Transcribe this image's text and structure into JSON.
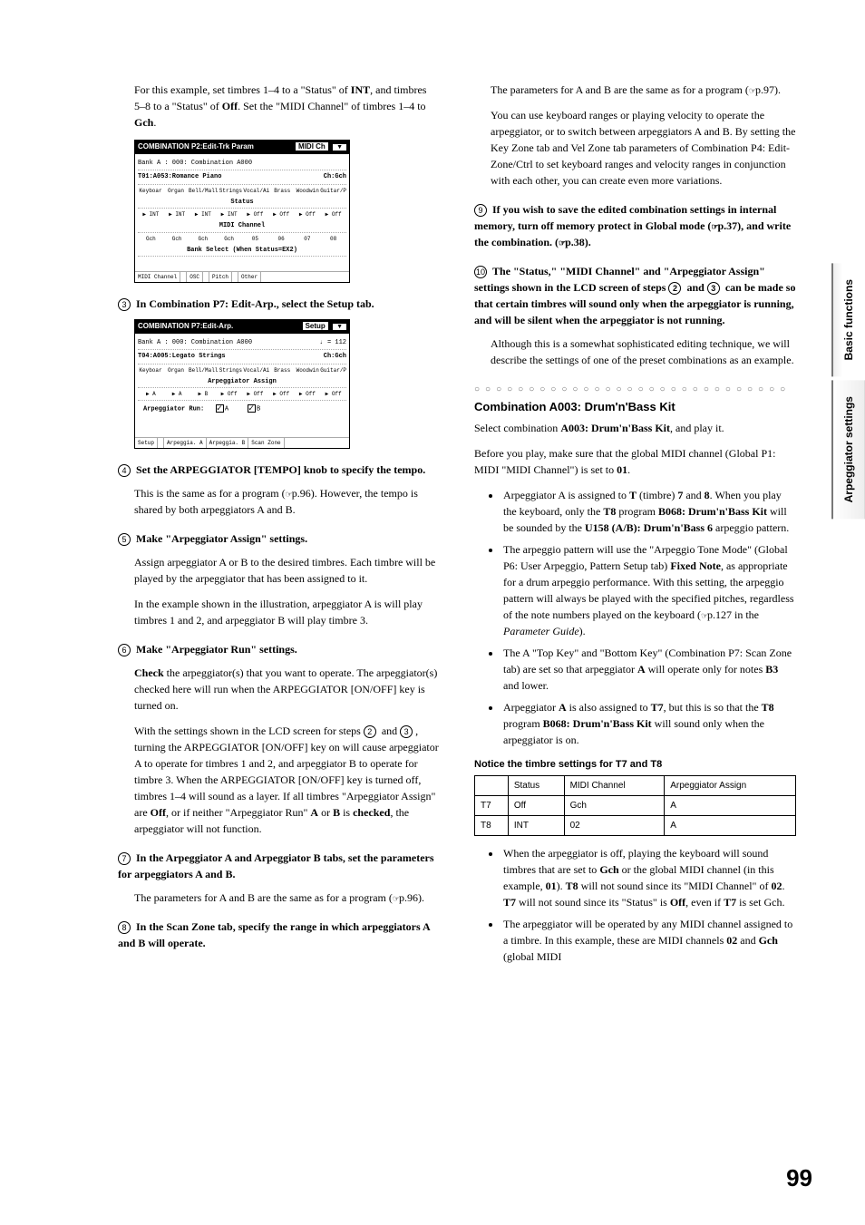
{
  "page_number": "99",
  "side_tabs": {
    "top": "Basic functions",
    "bottom": "Arpeggiator settings"
  },
  "left": {
    "intro": {
      "p1a": "For this example, set timbres 1–4 to a \"Status\" of ",
      "p1_int": "INT",
      "p1b": ", and timbres 5–8 to a \"Status\" of ",
      "p1_off": "Off",
      "p1c": ". Set the \"MIDI Channel\" of timbres 1–4 to ",
      "p1_gch": "Gch",
      "p1d": "."
    },
    "screenshot1": {
      "title": "COMBINATION P2:Edit-Trk Param",
      "title_label": "MIDI Ch",
      "bank_line": "Bank A : 000: Combination A000",
      "t01": "T01:A053:Romance Piano",
      "ch": "Ch:Gch",
      "instr": [
        "Keyboar",
        "Organ",
        "Bell/Mall",
        "Strings",
        "Vocal/Ai",
        "Brass",
        "Woodwin",
        "Guitar/P"
      ],
      "status_label": "Status",
      "status_row": [
        "▶ INT",
        "▶ INT",
        "▶ INT",
        "▶ INT",
        "▶ Off",
        "▶ Off",
        "▶ Off",
        "▶ Off"
      ],
      "midi_ch_label": "MIDI Channel",
      "midi_ch_row": [
        "Gch",
        "Gch",
        "Gch",
        "Gch",
        "05",
        "06",
        "07",
        "08"
      ],
      "bank_sel_label": "Bank Select (When Status=EX2)",
      "tabs": [
        "MIDI Channel",
        "",
        "OSC",
        "",
        "Pitch",
        "",
        "Other"
      ]
    },
    "step3": "In Combination P7: Edit-Arp., select the Setup tab.",
    "screenshot2": {
      "title": "COMBINATION P7:Edit-Arp.",
      "title_label": "Setup",
      "bank_line": "Bank A : 000: Combination A000",
      "tempo": "= 112",
      "t04": "T04:A005:Legato Strings",
      "ch": "Ch:Gch",
      "instr": [
        "Keyboar",
        "Organ",
        "Bell/Mall",
        "Strings",
        "Vocal/Ai",
        "Brass",
        "Woodwin",
        "Guitar/P"
      ],
      "assign_label": "Arpeggiator Assign",
      "assign_row": [
        "▶ A",
        "▶ A",
        "▶ B",
        "▶ Off",
        "▶ Off",
        "▶ Off",
        "▶ Off",
        "▶ Off"
      ],
      "run_label": "Arpeggiator Run:",
      "run_a": "A",
      "run_b": "B",
      "tabs": [
        "Setup",
        "",
        "Arpeggia. A",
        "Arpeggia. B",
        "Scan Zone"
      ]
    },
    "step4": "Set the ARPEGGIATOR [TEMPO] knob to specify the tempo.",
    "step4_p_a": "This is the same as for a program (",
    "step4_p_ref": "p.96",
    "step4_p_b": "). However, the tempo is shared by both arpeggiators A and B.",
    "step5": "Make \"Arpeggiator Assign\" settings.",
    "step5_p1": "Assign arpeggiator A or B to the desired timbres. Each timbre will be played by the arpeggiator that has been assigned to it.",
    "step5_p2": "In the example shown in the illustration, arpeggiator A is will play timbres 1 and 2, and arpeggiator B will play timbre 3.",
    "step6": "Make \"Arpeggiator Run\" settings.",
    "step6_p1_a": "Check",
    "step6_p1_b": " the arpeggiator(s) that you want to operate. The arpeggiator(s) checked here will run when the ARPEGGIATOR [ON/OFF] key is turned on.",
    "step6_p2_a": "With the settings shown in the LCD screen for steps ",
    "step6_p2_b": " and ",
    "step6_p2_c": ", turning the ARPEGGIATOR [ON/OFF] key on will cause arpeggiator A to operate for timbres 1 and 2, and arpeggiator B to operate for timbre 3. When the ARPEGGIATOR [ON/OFF] key is turned off, timbres 1–4 will sound as a layer.",
    "step6_p3_a": "If all timbres \"Arpeggiator Assign\" are ",
    "step6_p3_off": "Off",
    "step6_p3_b": ", or if neither \"Arpeggiator Run\" ",
    "step6_p3_A": "A",
    "step6_p3_c": " or ",
    "step6_p3_B": "B",
    "step6_p3_d": " is ",
    "step6_p3_checked": "checked",
    "step6_p3_e": ", the arpeggiator will not function.",
    "step7": "In the Arpeggiator A and Arpeggiator B tabs, set the parameters for arpeggiators A and B.",
    "step7_p_a": "The parameters for A and B are the same as for a program (",
    "step7_p_ref": "p.96",
    "step7_p_b": ").",
    "step8": "In the Scan Zone tab, specify the range in which arpeggiators A and B will operate."
  },
  "right": {
    "p1_a": "The parameters for A and B are the same as for a program (",
    "p1_ref": "p.97",
    "p1_b": ").",
    "p2": "You can use keyboard ranges or playing velocity to operate the arpeggiator, or to switch between arpeggiators A and B. By setting the Key Zone tab and Vel Zone tab parameters of Combination P4: Edit-Zone/Ctrl to set keyboard ranges and velocity ranges in conjunction with each other, you can create even more variations.",
    "step9_a": "If you wish to save the edited combination settings in internal memory, turn off memory protect in Global mode (",
    "step9_ref1": "p.37",
    "step9_b": "), and write the combination. (",
    "step9_ref2": "p.38",
    "step9_c": ").",
    "step10_a": "The \"Status,\" \"MIDI Channel\" and \"Arpeggiator Assign\" settings shown in the LCD screen of steps ",
    "step10_b": " and ",
    "step10_c": " can be made so that certain timbres will sound only when the arpeggiator is running, and will be silent when the arpeggiator is not running.",
    "p3": "Although this is a somewhat sophisticated editing technique, we will describe the settings of one of the preset combinations as an example.",
    "section_head": "Combination A003: Drum'n'Bass Kit",
    "p4_a": "Select combination ",
    "p4_bold": "A003: Drum'n'Bass Kit",
    "p4_b": ", and play it.",
    "p5_a": "Before you play, make sure that the global MIDI channel (Global P1: MIDI \"MIDI Channel\") is set to ",
    "p5_bold": "01",
    "p5_b": ".",
    "bullets1": {
      "b1_a": "Arpeggiator A is assigned to ",
      "b1_T": "T",
      "b1_b": " (timbre) ",
      "b1_7": "7",
      "b1_c": " and ",
      "b1_8": "8",
      "b1_d": ". When you play the keyboard, only the ",
      "b1_T8": "T8",
      "b1_e": " program ",
      "b1_prog": "B068: Drum'n'Bass Kit",
      "b1_f": " will be sounded by the ",
      "b1_u158": "U158 (A/B): Drum'n'Bass 6",
      "b1_g": " arpeggio pattern.",
      "b2_a": "The arpeggio pattern will use the \"Arpeggio Tone Mode\" (Global P6: User Arpeggio, Pattern Setup tab) ",
      "b2_fixed": "Fixed Note",
      "b2_b": ", as appropriate for a drum arpeggio performance. With this setting, the arpeggio pattern will always be played with the specified pitches, regardless of the note numbers played on the keyboard (",
      "b2_ref": "p.127",
      "b2_c": " in the ",
      "b2_guide": "Parameter Guide",
      "b2_d": ").",
      "b3_a": "The A \"Top Key\" and \"Bottom Key\" (Combination P7: Scan Zone tab) are set so that arpeggiator ",
      "b3_A": "A",
      "b3_b": " will operate only for notes ",
      "b3_B3": "B3",
      "b3_c": " and lower.",
      "b4_a": "Arpeggiator ",
      "b4_A": "A",
      "b4_b": " is also assigned to ",
      "b4_T7": "T7",
      "b4_c": ", but this is so that the ",
      "b4_T8": "T8",
      "b4_d": " program ",
      "b4_prog": "B068: Drum'n'Bass Kit",
      "b4_e": " will sound only when the arpeggiator is on."
    },
    "sub_head": "Notice the timbre settings for T7 and T8",
    "table": {
      "h1": "Status",
      "h2": "MIDI Channel",
      "h3": "Arpeggiator Assign",
      "r1c0": "T7",
      "r1c1": "Off",
      "r1c2": "Gch",
      "r1c3": "A",
      "r2c0": "T8",
      "r2c1": "INT",
      "r2c2": "02",
      "r2c3": "A"
    },
    "bullets2": {
      "b1_a": "When the arpeggiator is off, playing the keyboard will sound timbres that are set to ",
      "b1_gch": "Gch",
      "b1_b": " or the global MIDI channel (in this example, ",
      "b1_01": "01",
      "b1_c": "). ",
      "b1_T8": "T8",
      "b1_d": " will not sound since its \"MIDI Channel\" of ",
      "b1_02": "02",
      "b1_e": ". ",
      "b1_T7": "T7",
      "b1_f": " will not sound since its \"Status\" is ",
      "b1_off": "Off",
      "b1_g": ", even if ",
      "b1_T7b": "T7",
      "b1_h": " is set Gch.",
      "b2_a": "The arpeggiator will be operated by any MIDI channel assigned to a timbre. In this example, these are MIDI channels ",
      "b2_02": "02",
      "b2_b": " and ",
      "b2_gch": "Gch",
      "b2_c": " (global MIDI"
    }
  }
}
